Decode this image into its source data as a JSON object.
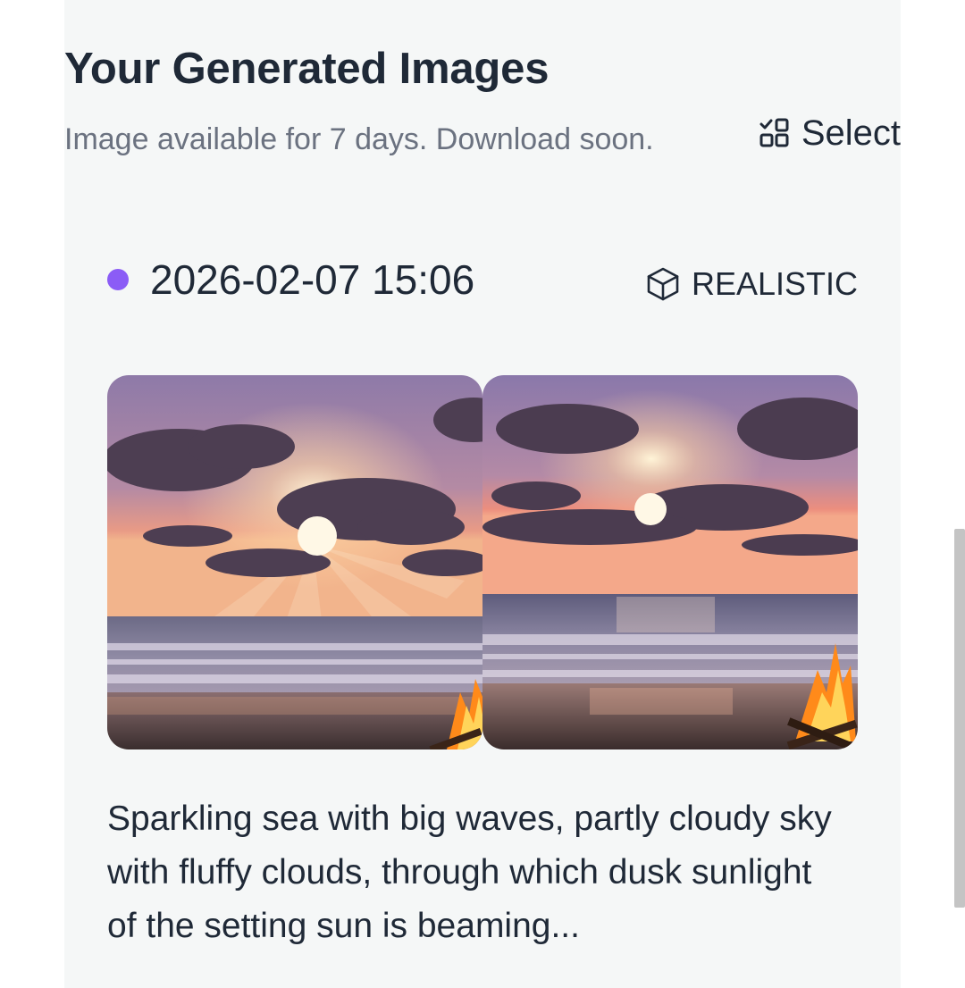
{
  "header": {
    "title": "Your Generated Images",
    "subtitle": "Image available for 7 days. Download soon.",
    "select_label": "Select",
    "select_icon": "select-grid-icon"
  },
  "entry": {
    "timestamp": "2026-02-07 15:06",
    "status_color": "#8b5cf6",
    "style_label": "REALISTIC",
    "style_icon": "cube-icon",
    "images": [
      {
        "alt": "Sunset over waves with beach bonfire, variant 1"
      },
      {
        "alt": "Sunset over waves with beach bonfire, variant 2"
      }
    ],
    "prompt": "Sparkling sea with big waves, partly cloudy sky with fluffy clouds, through which dusk sunlight of the setting sun is beaming..."
  },
  "colors": {
    "panel_bg": "#f5f7f7",
    "text_primary": "#1f2937",
    "text_secondary": "#6b7280",
    "accent": "#8b5cf6"
  }
}
